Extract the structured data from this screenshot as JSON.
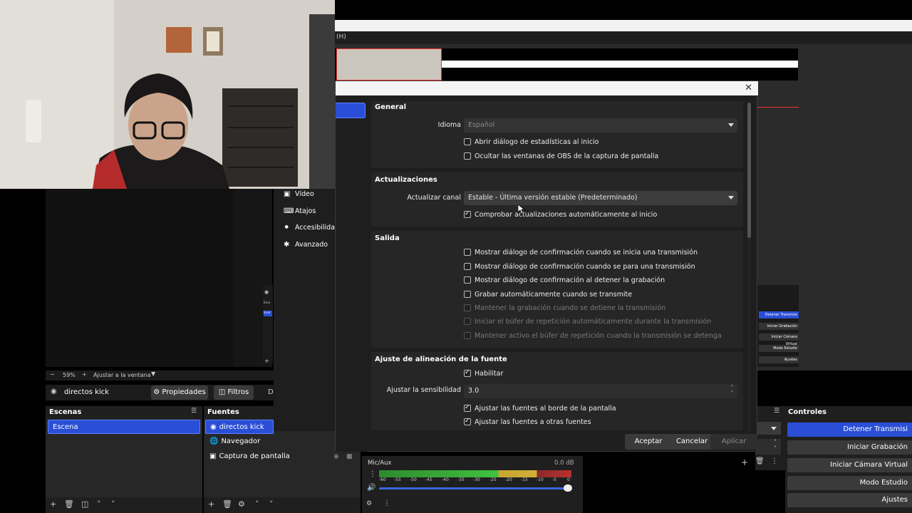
{
  "menubar": {
    "help_partial": "(H)"
  },
  "settings": {
    "side_items": [
      {
        "label": "Vídeo",
        "icon": "monitor-icon"
      },
      {
        "label": "Atajos",
        "icon": "keyboard-icon"
      },
      {
        "label": "Accesibilidad",
        "icon": "accessibility-icon"
      },
      {
        "label": "Avanzado",
        "icon": "wrench-icon"
      }
    ],
    "general": {
      "title": "General",
      "language_label": "Idioma",
      "language_value": "Español",
      "checks": [
        {
          "label": "Abrir diálogo de estadísticas al inicio",
          "checked": false
        },
        {
          "label": "Ocultar las ventanas de OBS de la captura de pantalla",
          "checked": false
        }
      ]
    },
    "updates": {
      "title": "Actualizaciones",
      "channel_label": "Actualizar canal",
      "channel_value": "Estable - Última versión estable (Predeterminado)",
      "check_label": "Comprobar actualizaciones automáticamente al inicio"
    },
    "output": {
      "title": "Salida",
      "checks": [
        {
          "label": "Mostrar diálogo de confirmación cuando se inicia una transmisión"
        },
        {
          "label": "Mostrar diálogo de confirmación cuando se para una transmisión"
        },
        {
          "label": "Mostrar diálogo de confirmación al detener la grabación"
        },
        {
          "label": "Grabar automáticamente cuando se transmite"
        },
        {
          "label": "Mantener la grabación cuando se detiene la transmisión"
        },
        {
          "label": "Iniciar el búfer de repetición automáticamente durante la transmisión"
        },
        {
          "label": "Mantener activo el búfer de repetición cuando la transmisión se detenga"
        }
      ]
    },
    "snapping": {
      "title": "Ajuste de alineación de la fuente",
      "enable_label": "Habilitar",
      "sensitivity_label": "Ajustar la sensibilidad",
      "sensitivity_value": "3.0",
      "screen_edge_label": "Ajustar las fuentes al borde de la pantalla",
      "other_sources_label": "Ajustar las fuentes a otras fuentes"
    },
    "buttons": {
      "accept": "Aceptar",
      "cancel": "Cancelar",
      "apply": "Aplicar"
    }
  },
  "obs": {
    "zoom": "59%",
    "fit_label": "Ajustar a la ventana",
    "source_name": "directos kick",
    "properties_label": "Propiedades",
    "filters_label": "Filtros",
    "d_partial": "D",
    "scenes_title": "Escenas",
    "scene_item": "Escena",
    "sources_title": "Fuentes",
    "sources": [
      "directos kick",
      "Navegador",
      "Captura de pantalla"
    ],
    "mixer": {
      "channel": "Mic/Aux",
      "db": "0.0 dB",
      "ticks": [
        "-60",
        "-55",
        "-50",
        "-45",
        "-40",
        "-35",
        "-30",
        "-25",
        "-20",
        "-15",
        "-10",
        "-5",
        "0"
      ]
    },
    "controls_title": "Controles",
    "controls": [
      "Detener Transmisi",
      "Iniciar Grabación",
      "Iniciar Cámara Virtual",
      "Modo Estudio",
      "Ajustes"
    ],
    "mini_controls": [
      "Detener Transmisi",
      "Iniciar Grabación",
      "Iniciar Cámara Virtual",
      "Modo Estudio",
      "Ajustes"
    ],
    "mini_scene_items": [
      "Esce",
      "Esce"
    ]
  }
}
